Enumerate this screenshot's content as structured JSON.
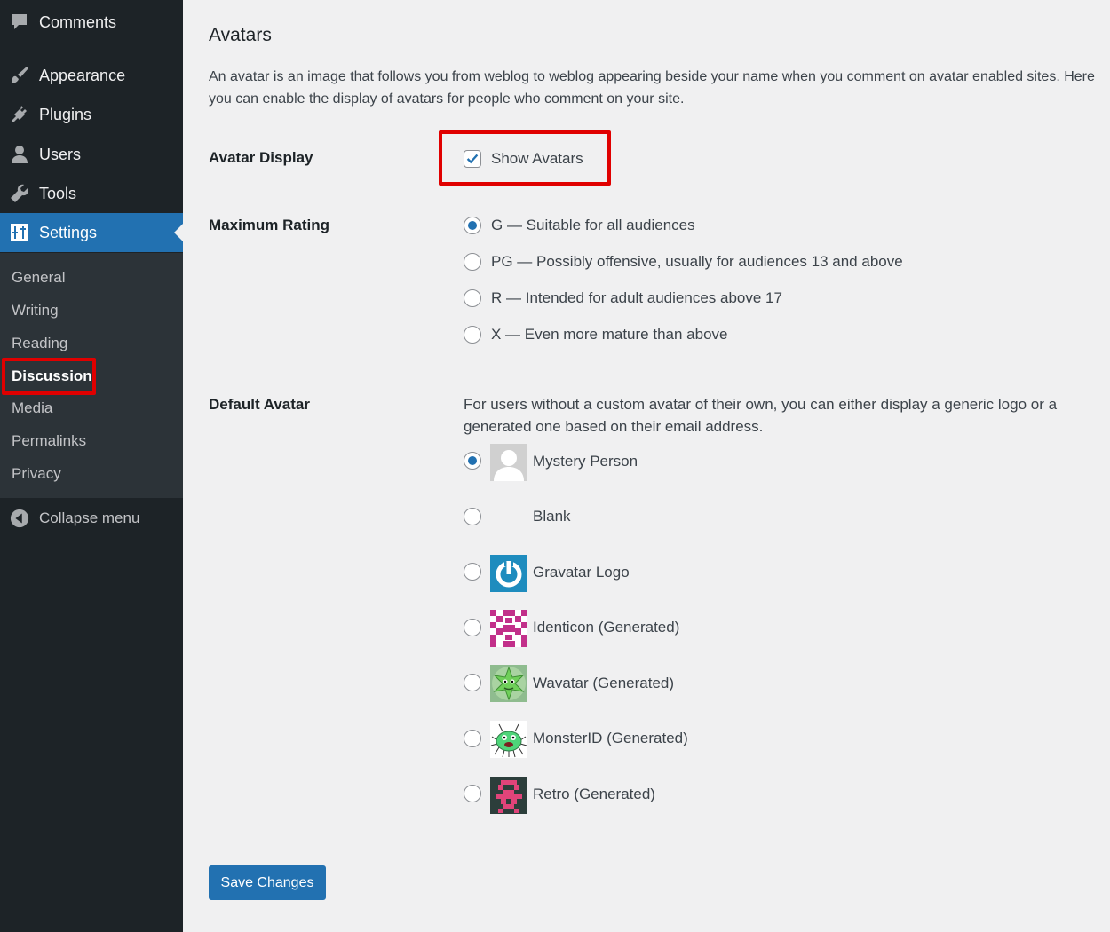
{
  "sidebar": {
    "items": [
      {
        "label": "Comments",
        "icon": "comments-icon"
      },
      {
        "label": "Appearance",
        "icon": "paintbrush-icon"
      },
      {
        "label": "Plugins",
        "icon": "plug-icon"
      },
      {
        "label": "Users",
        "icon": "user-icon"
      },
      {
        "label": "Tools",
        "icon": "wrench-icon"
      },
      {
        "label": "Settings",
        "icon": "settings-icon",
        "active": true
      }
    ],
    "submenu": [
      "General",
      "Writing",
      "Reading",
      "Discussion",
      "Media",
      "Permalinks",
      "Privacy"
    ],
    "current_submenu": "Discussion",
    "collapse_label": "Collapse menu",
    "accent_color": "#2271b1",
    "highlight_color": "#e00000"
  },
  "main": {
    "section_title": "Avatars",
    "section_description": "An avatar is an image that follows you from weblog to weblog appearing beside your name when you comment on avatar enabled sites. Here you can enable the display of avatars for people who comment on your site.",
    "avatar_display": {
      "label": "Avatar Display",
      "checkbox_label": "Show Avatars",
      "checked": true
    },
    "maximum_rating": {
      "label": "Maximum Rating",
      "options": [
        {
          "label": "G — Suitable for all audiences",
          "checked": true
        },
        {
          "label": "PG — Possibly offensive, usually for audiences 13 and above",
          "checked": false
        },
        {
          "label": "R — Intended for adult audiences above 17",
          "checked": false
        },
        {
          "label": "X — Even more mature than above",
          "checked": false
        }
      ]
    },
    "default_avatar": {
      "label": "Default Avatar",
      "description": "For users without a custom avatar of their own, you can either display a generic logo or a generated one based on their email address.",
      "options": [
        {
          "label": "Mystery Person",
          "icon": "mystery-person-avatar",
          "checked": true
        },
        {
          "label": "Blank",
          "icon": "blank-avatar",
          "checked": false
        },
        {
          "label": "Gravatar Logo",
          "icon": "gravatar-logo-avatar",
          "checked": false
        },
        {
          "label": "Identicon (Generated)",
          "icon": "identicon-avatar",
          "checked": false
        },
        {
          "label": "Wavatar (Generated)",
          "icon": "wavatar-avatar",
          "checked": false
        },
        {
          "label": "MonsterID (Generated)",
          "icon": "monsterid-avatar",
          "checked": false
        },
        {
          "label": "Retro (Generated)",
          "icon": "retro-avatar",
          "checked": false
        }
      ]
    },
    "save_button": "Save Changes"
  }
}
